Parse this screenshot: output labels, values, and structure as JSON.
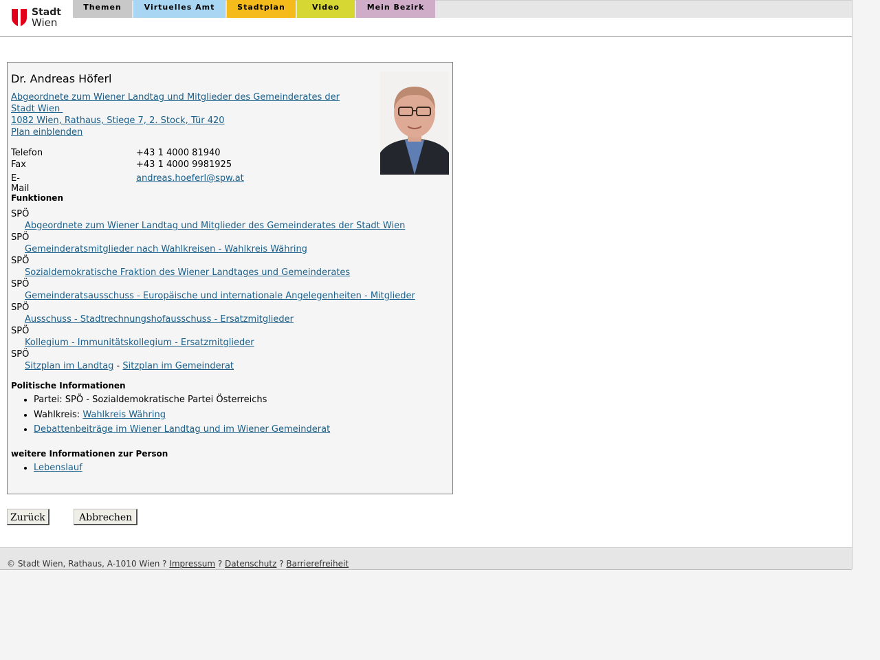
{
  "header": {
    "logo_line1": "Stadt",
    "logo_line2": "Wien",
    "nav": [
      {
        "label": "Themen",
        "color": "#c8c8c8"
      },
      {
        "label": "Virtuelles Amt",
        "color": "#a9d6f2"
      },
      {
        "label": "Stadtplan",
        "color": "#f5bb1b"
      },
      {
        "label": "Video",
        "color": "#d6d733"
      },
      {
        "label": "Mein Bezirk",
        "color": "#cfadc8"
      }
    ]
  },
  "person": {
    "name": "Dr. Andreas Höferl",
    "role_link_line1": "Abgeordnete zum Wiener Landtag und Mitglieder des Gemeinderates der",
    "role_link_line2": "Stadt Wien ",
    "address": "1082 Wien, Rathaus, Stiege 7, 2. Stock, Tür 420",
    "plan_link": "Plan einblenden",
    "contact": [
      {
        "label": "Telefon",
        "value": "+43 1 4000 81940",
        "link": false
      },
      {
        "label": "Fax",
        "value": "+43 1 4000 9981925",
        "link": false
      },
      {
        "label": "E-Mail",
        "value": "andreas.hoeferl@spw.at",
        "link": true
      }
    ]
  },
  "functions": {
    "title": "Funktionen",
    "items": [
      {
        "party": "SPÖ",
        "link": "Abgeordnete zum Wiener Landtag und Mitglieder des Gemeinderates der Stadt Wien"
      },
      {
        "party": "SPÖ",
        "link": "Gemeinderatsmitglieder nach Wahlkreisen - Wahlkreis Währing"
      },
      {
        "party": "SPÖ",
        "link": "Sozialdemokratische Fraktion des Wiener Landtages und Gemeinderates"
      },
      {
        "party": "SPÖ",
        "link": "Gemeinderatsausschuss - Europäische und internationale Angelegenheiten - Mitglieder"
      },
      {
        "party": "SPÖ",
        "link": "Ausschuss - Stadtrechnungshofausschuss - Ersatzmitglieder"
      },
      {
        "party": "SPÖ",
        "link": "Kollegium - Immunitätskollegium - Ersatzmitglieder"
      }
    ],
    "last": {
      "party": "SPÖ",
      "link1": "Sitzplan im Landtag",
      "separator": " - ",
      "link2": "Sitzplan im Gemeinderat"
    }
  },
  "political": {
    "title": "Politische Informationen",
    "partei": "Partei: SPÖ - Sozialdemokratische Partei Österreichs",
    "wahlkreis_label": "Wahlkreis: ",
    "wahlkreis_link": "Wahlkreis Währing",
    "debatten_link": "Debattenbeiträge im Wiener Landtag und im Wiener Gemeinderat"
  },
  "further": {
    "title": "weitere Informationen zur Person",
    "lebenslauf": "Lebenslauf"
  },
  "buttons": {
    "back": "Zurück",
    "cancel": "Abbrechen"
  },
  "footer": {
    "copyright": "© Stadt Wien, Rathaus, A-1010 Wien",
    "sep": " ? ",
    "impressum": "Impressum",
    "datenschutz": "Datenschutz",
    "barrierefreiheit": "Barrierefreiheit"
  }
}
